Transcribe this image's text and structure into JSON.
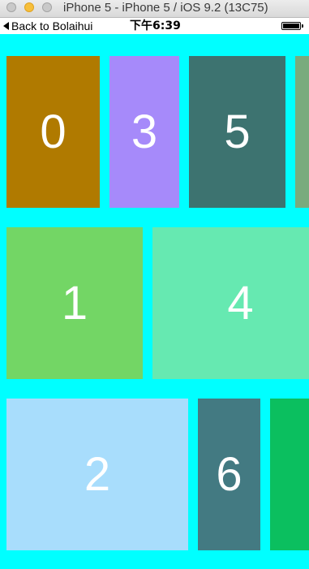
{
  "window": {
    "title": "iPhone 5 - iPhone 5 / iOS 9.2 (13C75)"
  },
  "status_bar": {
    "back_label": "Back to Bolaihui",
    "time": "下午6:39",
    "battery_level": 1.0
  },
  "content": {
    "background": "#00ffff",
    "tiles": [
      {
        "label": "0",
        "color": "#b07a00"
      },
      {
        "label": "3",
        "color": "#a68afa"
      },
      {
        "label": "5",
        "color": "#3d7370"
      },
      {
        "label": "",
        "color": "#79ab7d"
      },
      {
        "label": "1",
        "color": "#73d665"
      },
      {
        "label": "4",
        "color": "#66e9b1"
      },
      {
        "label": "2",
        "color": "#a8ddfc"
      },
      {
        "label": "6",
        "color": "#437a82"
      },
      {
        "label": "",
        "color": "#0bbf5f"
      }
    ]
  }
}
